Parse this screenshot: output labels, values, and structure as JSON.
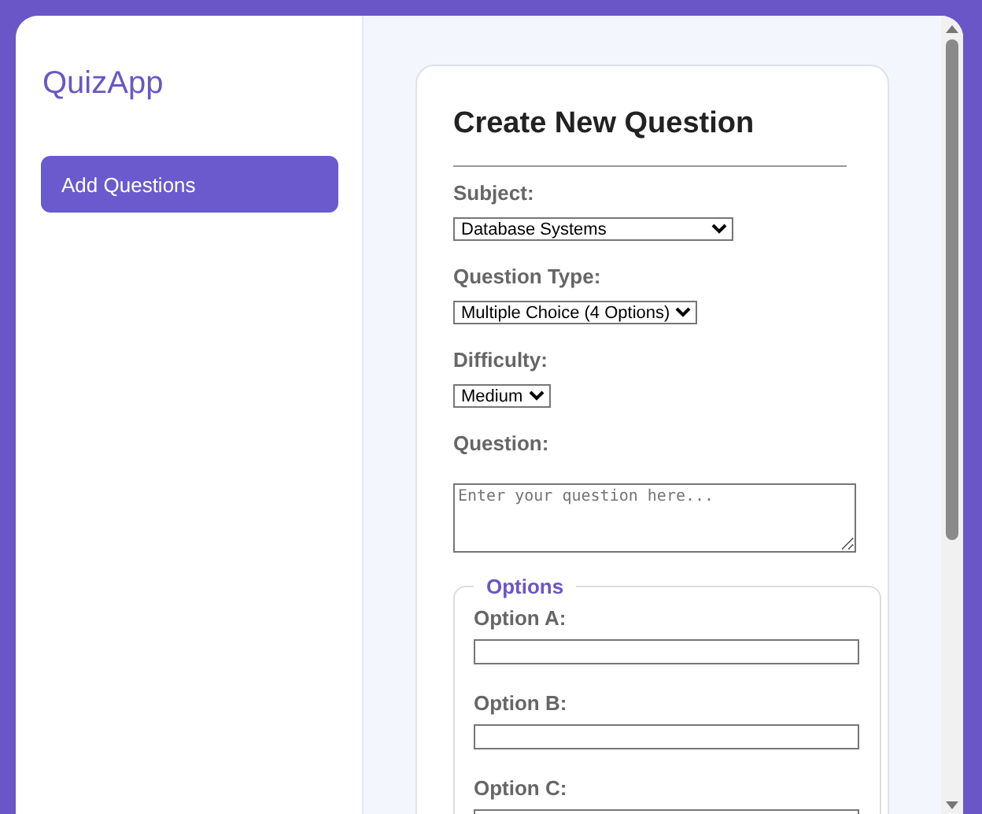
{
  "sidebar": {
    "brand": "QuizApp",
    "items": [
      {
        "label": "Add Questions",
        "selected": true
      }
    ]
  },
  "form": {
    "title": "Create New Question",
    "fields": [
      {
        "kind": "select",
        "label": "Subject:",
        "value": "Database Systems"
      },
      {
        "kind": "select",
        "label": "Question Type:",
        "value": "Multiple Choice (4 Options)"
      },
      {
        "kind": "select",
        "label": "Difficulty:",
        "value": "Medium"
      },
      {
        "kind": "textarea",
        "label": "Question:",
        "placeholder": "Enter your question here..."
      }
    ],
    "options": {
      "legend": "Options",
      "items": [
        {
          "label": "Option A:"
        },
        {
          "label": "Option B:"
        },
        {
          "label": "Option C:"
        }
      ]
    }
  }
}
